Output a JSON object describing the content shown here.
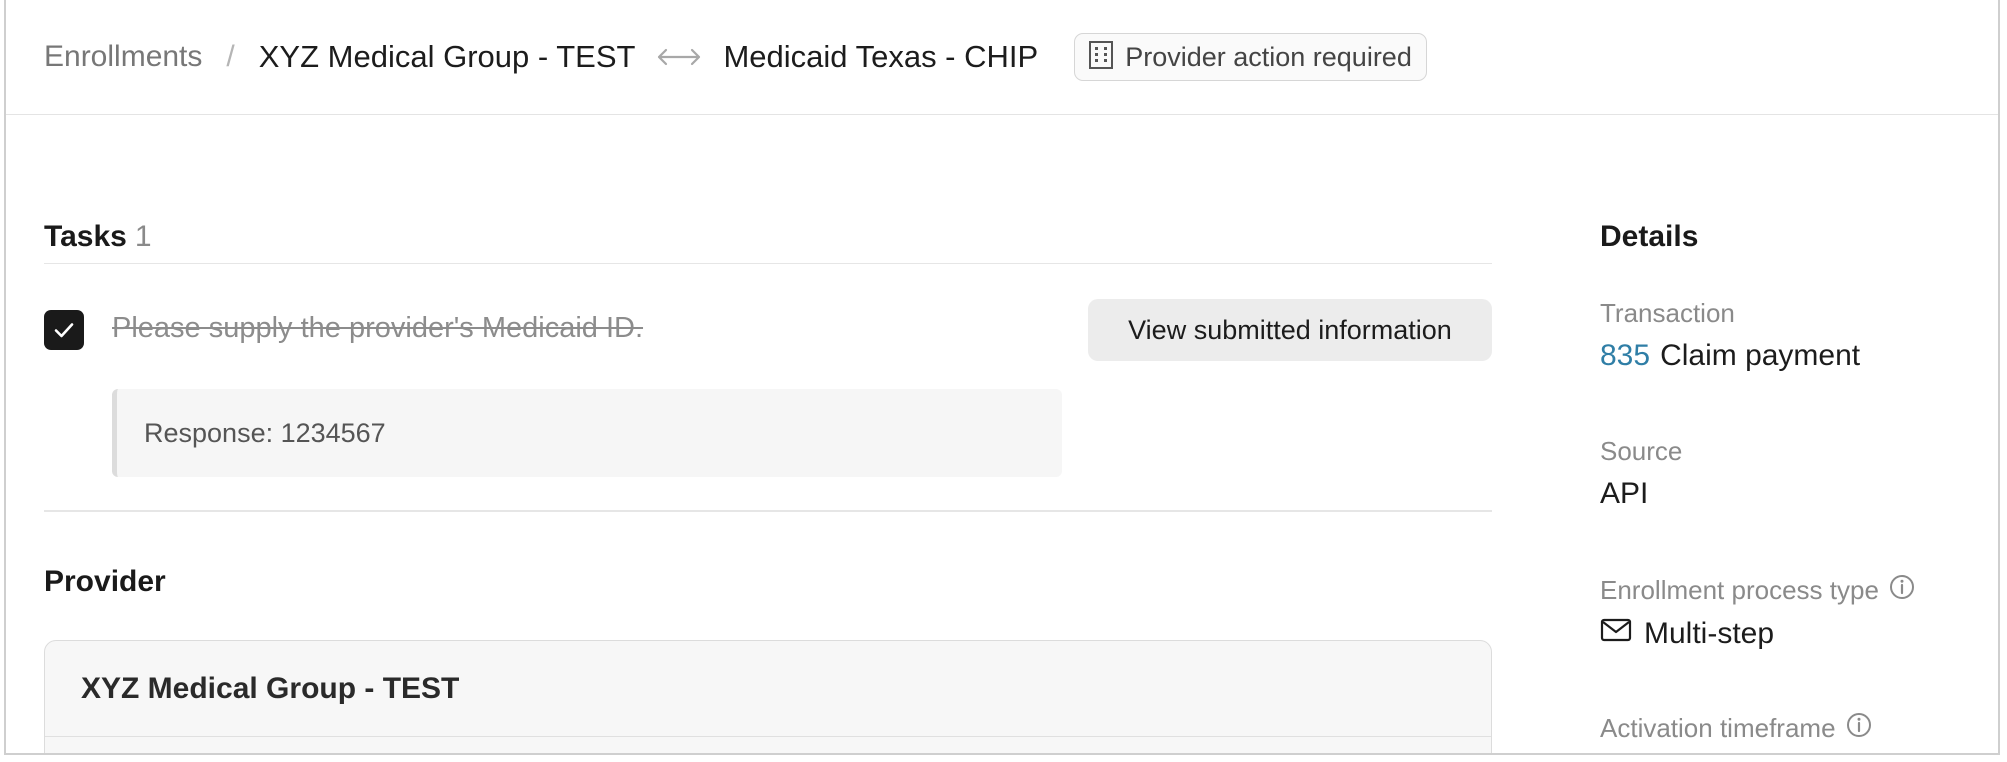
{
  "breadcrumb": {
    "root": "Enrollments",
    "separator": "/",
    "provider": "XYZ Medical Group - TEST",
    "payer": "Medicaid Texas - CHIP"
  },
  "status_badge": {
    "label": "Provider action required",
    "icon": "building-icon"
  },
  "tasks": {
    "title": "Tasks",
    "count": "1",
    "items": [
      {
        "text": "Please supply the provider's Medicaid ID.",
        "completed": true,
        "button_label": "View submitted information",
        "response": "Response: 1234567"
      }
    ]
  },
  "provider": {
    "title": "Provider",
    "name": "XYZ Medical Group - TEST"
  },
  "details": {
    "title": "Details",
    "transaction": {
      "label": "Transaction",
      "code": "835",
      "value": "Claim payment"
    },
    "source": {
      "label": "Source",
      "value": "API"
    },
    "process_type": {
      "label": "Enrollment process type",
      "value": "Multi-step",
      "icon": "mail-icon"
    },
    "activation": {
      "label": "Activation timeframe"
    }
  },
  "colors": {
    "accent": "#2f7ea6",
    "checkbox": "#1a1a1a"
  }
}
